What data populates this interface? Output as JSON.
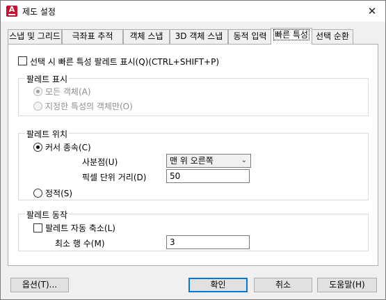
{
  "window": {
    "title": "제도 설정",
    "app_icon_letter": "A"
  },
  "tabs": [
    {
      "label": "스냅 및 그리드"
    },
    {
      "label": "극좌표 추적"
    },
    {
      "label": "객체 스냅"
    },
    {
      "label": "3D 객체 스냅"
    },
    {
      "label": "동적 입력"
    },
    {
      "label": "빠른 특성"
    },
    {
      "label": "선택 순환"
    }
  ],
  "active_tab": "빠른 특성",
  "quick_props": {
    "show_palette_label": "선택 시 빠른 특성 팔레트 표시(Q)(CTRL+SHIFT+P)",
    "show_palette_checked": false
  },
  "palette_display": {
    "title": "팔레트 표시",
    "all_objects_label": "모든 객체(A)",
    "specified_label": "지정한 특성의 객체만(O)",
    "selected": "all_objects",
    "enabled": false
  },
  "palette_location": {
    "title": "팔레트 위치",
    "cursor_label": "커서 종속(C)",
    "quadrant_label": "사분점(U)",
    "quadrant_value": "맨 위 오른쪽",
    "distance_label": "픽셀 단위 거리(D)",
    "distance_value": "50",
    "static_label": "정적(S)",
    "selected": "cursor"
  },
  "palette_behavior": {
    "title": "팔레트 동작",
    "collapse_label": "팔레트 자동 축소(L)",
    "collapse_checked": false,
    "min_rows_label": "최소 행 수(M)",
    "min_rows_value": "3"
  },
  "buttons": {
    "options": "옵션(T)...",
    "ok": "확인",
    "cancel": "취소",
    "help": "도움말(H)"
  }
}
